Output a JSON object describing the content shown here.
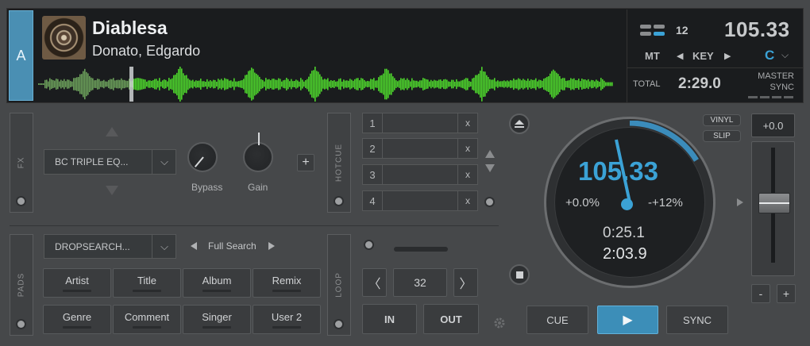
{
  "deck": {
    "letter": "A",
    "title": "Diablesa",
    "artist": "Donato, Edgardo",
    "layer_number": "12",
    "bpm": "105.33",
    "mt_label": "MT",
    "key_label": "KEY",
    "key_value": "C",
    "total_label": "TOTAL",
    "total_time": "2:29.0",
    "master_label": "MASTER",
    "sync_label": "SYNC",
    "icons": {
      "key_left": "◀",
      "key_right": "▶",
      "chevron": "⌵"
    }
  },
  "fx": {
    "tab_label": "FX",
    "effect_name": "BC TRIPLE EQ...",
    "knobs": [
      {
        "label": "Bypass"
      },
      {
        "label": "Gain"
      }
    ],
    "add_label": "+"
  },
  "hotcue": {
    "tab_label": "HOTCUE",
    "slots": [
      {
        "number": "1",
        "clear": "x"
      },
      {
        "number": "2",
        "clear": "x"
      },
      {
        "number": "3",
        "clear": "x"
      },
      {
        "number": "4",
        "clear": "x"
      }
    ]
  },
  "pads": {
    "tab_label": "PADS",
    "mode": "DROPSEARCH...",
    "search_mode": "Full Search",
    "buttons": [
      "Artist",
      "Title",
      "Album",
      "Remix",
      "Genre",
      "Comment",
      "Singer",
      "User 2"
    ]
  },
  "loop": {
    "tab_label": "LOOP",
    "size": "32",
    "prev": "〈",
    "next": "〉",
    "in_label": "IN",
    "out_label": "OUT"
  },
  "jog": {
    "bpm": "105.33",
    "pitch_percent": "+0.0%",
    "range": "-+12%",
    "elapsed": "0:25.1",
    "remain": "2:03.9"
  },
  "transport": {
    "cue_label": "CUE",
    "play_label": "▶",
    "sync_label": "SYNC",
    "vinyl_label": "VINYL",
    "slip_label": "SLIP"
  },
  "pitch": {
    "value": "+0.0",
    "minus_label": "-",
    "plus_label": "+"
  },
  "colors": {
    "accent_blue": "#3ba2d6",
    "waveform_green": "#4cd22c",
    "deck_tab": "#4a8fb3"
  }
}
